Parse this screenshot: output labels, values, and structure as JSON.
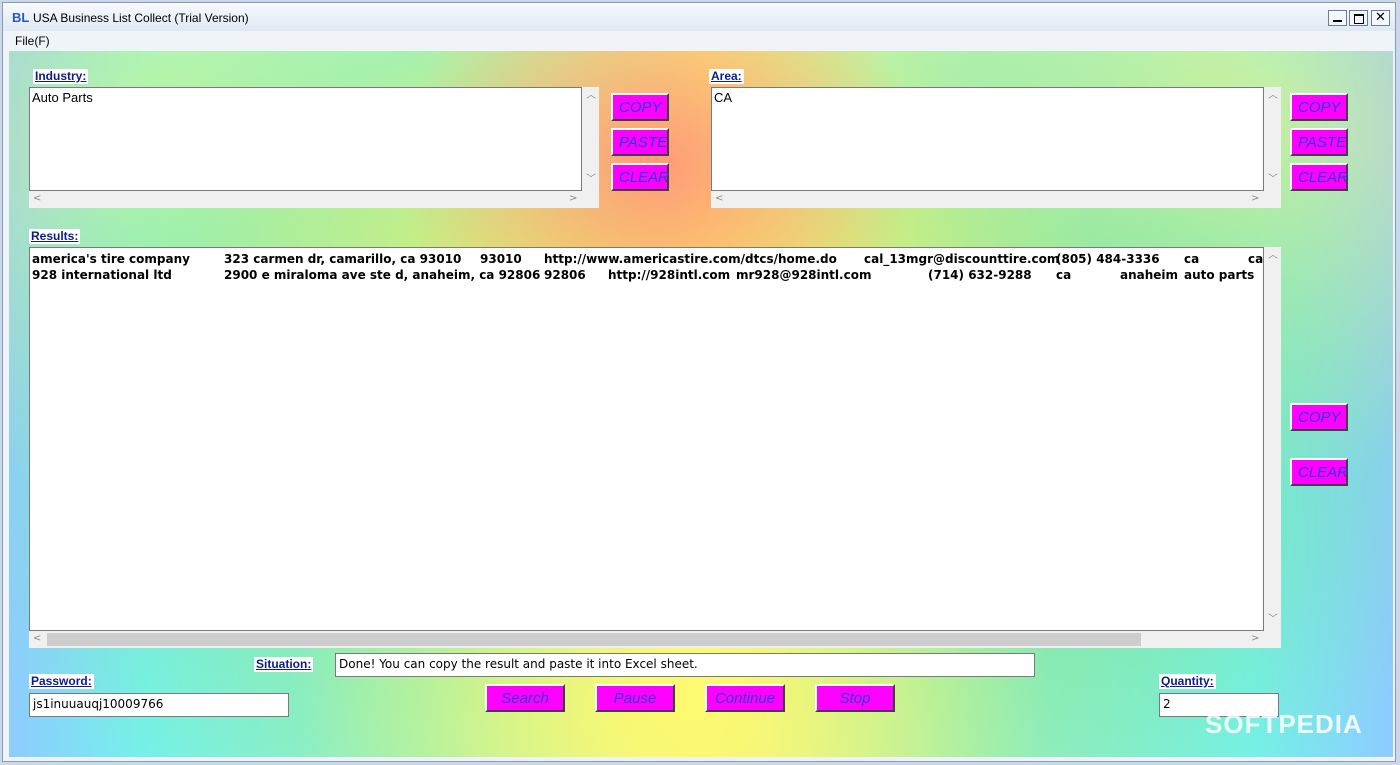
{
  "window": {
    "logo": "BL",
    "title": "USA Business List Collect (Trial Version)"
  },
  "menu": {
    "file": "File(F)"
  },
  "industry": {
    "label": "Industry:",
    "value": "Auto Parts"
  },
  "area": {
    "label": "Area:",
    "value": "CA"
  },
  "buttons": {
    "copy": "COPY",
    "paste": "PASTE",
    "clear": "CLEAR"
  },
  "results": {
    "label": "Results:",
    "rows": [
      {
        "name": "america's tire company",
        "address": "323 carmen dr, camarillo, ca 93010",
        "zip": "93010",
        "url": "http://www.americastire.com/dtcs/home.do",
        "email": "cal_13mgr@discounttire.com",
        "phone": "(805) 484-3336",
        "state": "ca",
        "city": "ca"
      },
      {
        "name": "928 international ltd",
        "address": "2900 e miraloma ave ste d, anaheim, ca 92806",
        "zip": "92806",
        "url": "http://928intl.com",
        "email": "mr928@928intl.com",
        "phone": "(714) 632-9288",
        "state": "ca",
        "city": "anaheim",
        "industry": "auto parts"
      }
    ]
  },
  "situation": {
    "label": "Situation:",
    "value": "Done! You can copy the result and paste it into Excel sheet."
  },
  "password": {
    "label": "Password:",
    "value": "js1inuuauqj10009766"
  },
  "quantity": {
    "label": "Quantity:",
    "value": "2"
  },
  "actions": {
    "search": "Search",
    "pause": "Pause",
    "continue": "Continue",
    "stop": "Stop"
  },
  "watermark": "SOFTPEDIA"
}
